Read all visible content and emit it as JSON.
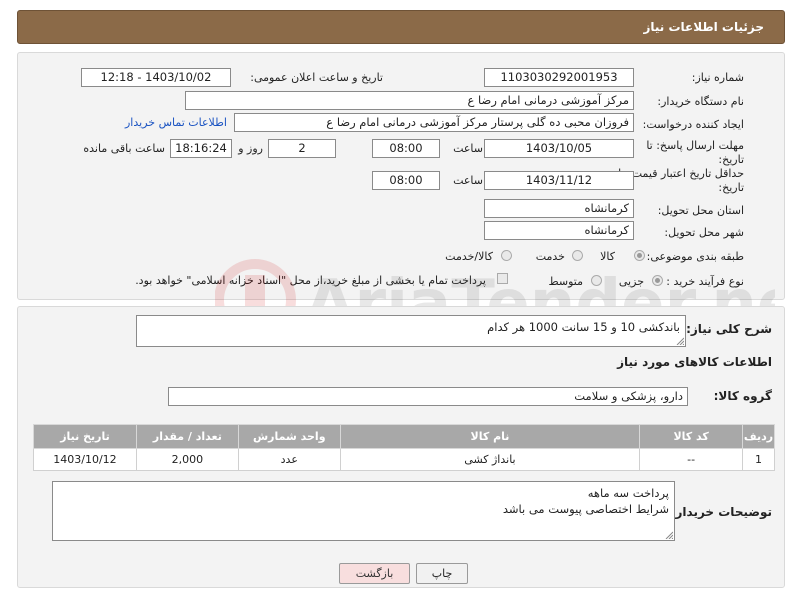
{
  "header": {
    "title": "جزئیات اطلاعات نیاز"
  },
  "form": {
    "need_number_label": "شماره نیاز:",
    "need_number": "1103030292001953",
    "announce_label": "تاریخ و ساعت اعلان عمومی:",
    "announce_value": "1403/10/02 - 12:18",
    "buyer_org_label": "نام دستگاه خریدار:",
    "buyer_org": "مرکز آموزشی  درمانی امام رضا  ع",
    "creator_label": "ایجاد کننده درخواست:",
    "creator": "فروزان محبی ده گلی پرستار مرکز آموزشی  درمانی امام رضا  ع",
    "contact_link": "اطلاعات تماس خریدار",
    "reply_deadline_label": "مهلت ارسال پاسخ: تا تاریخ:",
    "reply_date": "1403/10/05",
    "time_label": "ساعت",
    "reply_time": "08:00",
    "days_value": "2",
    "days_label": "روز و",
    "remaining_time": "18:16:24",
    "remaining_label": "ساعت باقی مانده",
    "price_validity_label": "حداقل تاریخ اعتبار قیمت: تا تاریخ:",
    "price_date": "1403/11/12",
    "price_time": "08:00",
    "province_label": "استان محل تحویل:",
    "province": "کرمانشاه",
    "city_label": "شهر محل تحویل:",
    "city": "کرمانشاه",
    "category_label": "طبقه بندی موضوعی:",
    "category_options": [
      "کالا",
      "خدمت",
      "کالا/خدمت"
    ],
    "category_selected": "کالا",
    "process_label": "نوع فرآیند خرید :",
    "process_options": [
      "جزیی",
      "متوسط"
    ],
    "process_selected": "جزیی",
    "payment_note": "پرداخت تمام یا بخشی از مبلغ خرید،از محل \"اسناد خزانه اسلامی\" خواهد بود."
  },
  "details": {
    "description_label": "شرح کلی نیاز:",
    "description": "باندکشی   10 و 15 سانت    1000 هر کدام",
    "goods_info_title": "اطلاعات کالاهای مورد نیاز",
    "goods_group_label": "گروه کالا:",
    "goods_group": "دارو، پزشکی و سلامت",
    "table": {
      "headers": [
        "ردیف",
        "کد کالا",
        "نام کالا",
        "واحد شمارش",
        "تعداد / مقدار",
        "تاریخ نیاز"
      ],
      "rows": [
        [
          "1",
          "--",
          "بانداژ کشی",
          "عدد",
          "2,000",
          "1403/10/12"
        ]
      ]
    },
    "buyer_notes_label": "توضیحات خریدار:",
    "buyer_notes_line1": "پرداخت سه ماهه",
    "buyer_notes_line2": "شرایط اختصاصی پیوست می باشد"
  },
  "buttons": {
    "print": "چاپ",
    "back": "بازگشت"
  },
  "colors": {
    "header_bg": "#8b6a48",
    "table_header_bg": "#a8a8a8",
    "link": "#1a53c2"
  }
}
